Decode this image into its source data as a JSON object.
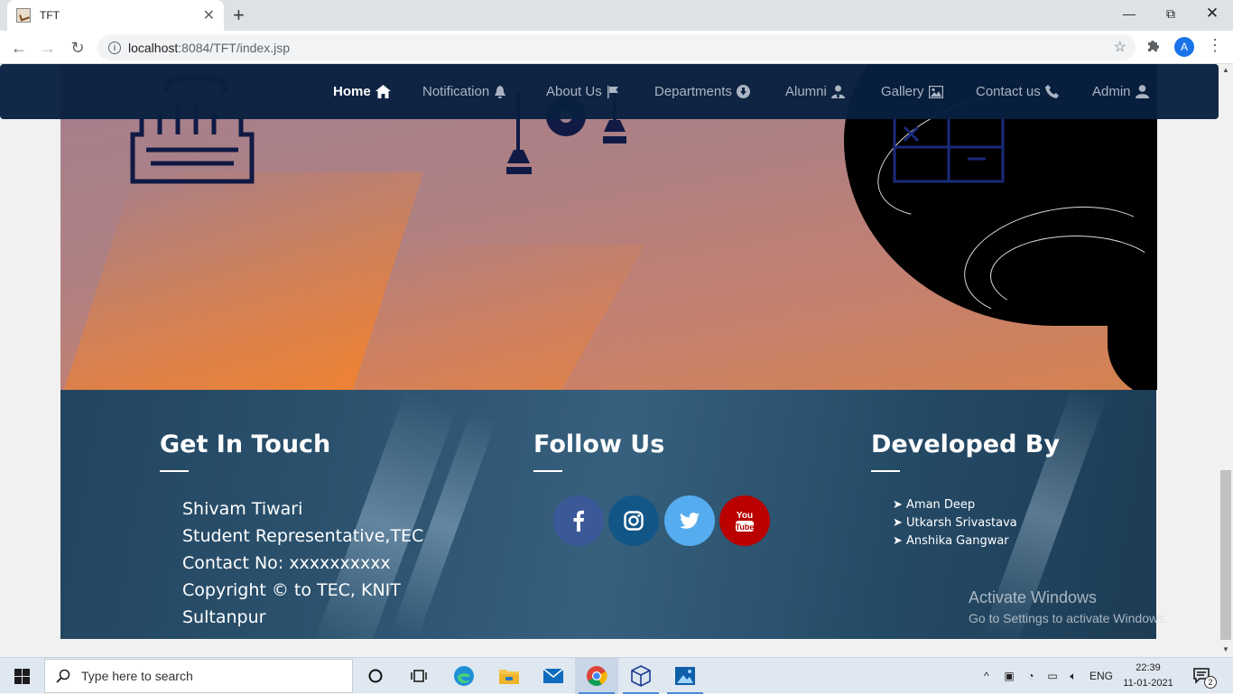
{
  "browser": {
    "tab_title": "TFT",
    "url_host": "localhost",
    "url_rest": ":8084/TFT/index.jsp",
    "avatar_letter": "A"
  },
  "nav": {
    "items": [
      {
        "label": "Home",
        "icon": "home-icon"
      },
      {
        "label": "Notification",
        "icon": "bell-icon"
      },
      {
        "label": "About Us",
        "icon": "flag-icon"
      },
      {
        "label": "Departments",
        "icon": "arrow-circle-down-icon"
      },
      {
        "label": "Alumni",
        "icon": "user-tie-icon"
      },
      {
        "label": "Gallery",
        "icon": "image-icon"
      },
      {
        "label": "Contact us",
        "icon": "phone-icon"
      },
      {
        "label": "Admin",
        "icon": "user-icon"
      }
    ]
  },
  "footer": {
    "get_in_touch": {
      "heading": "Get In Touch",
      "lines": [
        "Shivam Tiwari",
        "Student Representative,TEC",
        "Contact No: xxxxxxxxxx",
        "Copyright ©   to TEC, KNIT",
        "Sultanpur"
      ]
    },
    "follow_us": {
      "heading": "Follow Us",
      "socials": [
        {
          "name": "facebook",
          "color": "#3b5998"
        },
        {
          "name": "instagram",
          "color": "#125688"
        },
        {
          "name": "twitter",
          "color": "#55acee"
        },
        {
          "name": "youtube",
          "color": "#bb0000"
        }
      ]
    },
    "developed_by": {
      "heading": "Developed By",
      "names": [
        "➤ Aman Deep",
        "➤ Utkarsh Srivastava",
        "➤ Anshika Gangwar"
      ]
    }
  },
  "watermark": {
    "title": "Activate Windows",
    "subtitle": "Go to Settings to activate Windows."
  },
  "taskbar": {
    "search_placeholder": "Type here to search",
    "language": "ENG",
    "time": "22:39",
    "date": "11-01-2021",
    "notification_count": "2"
  }
}
